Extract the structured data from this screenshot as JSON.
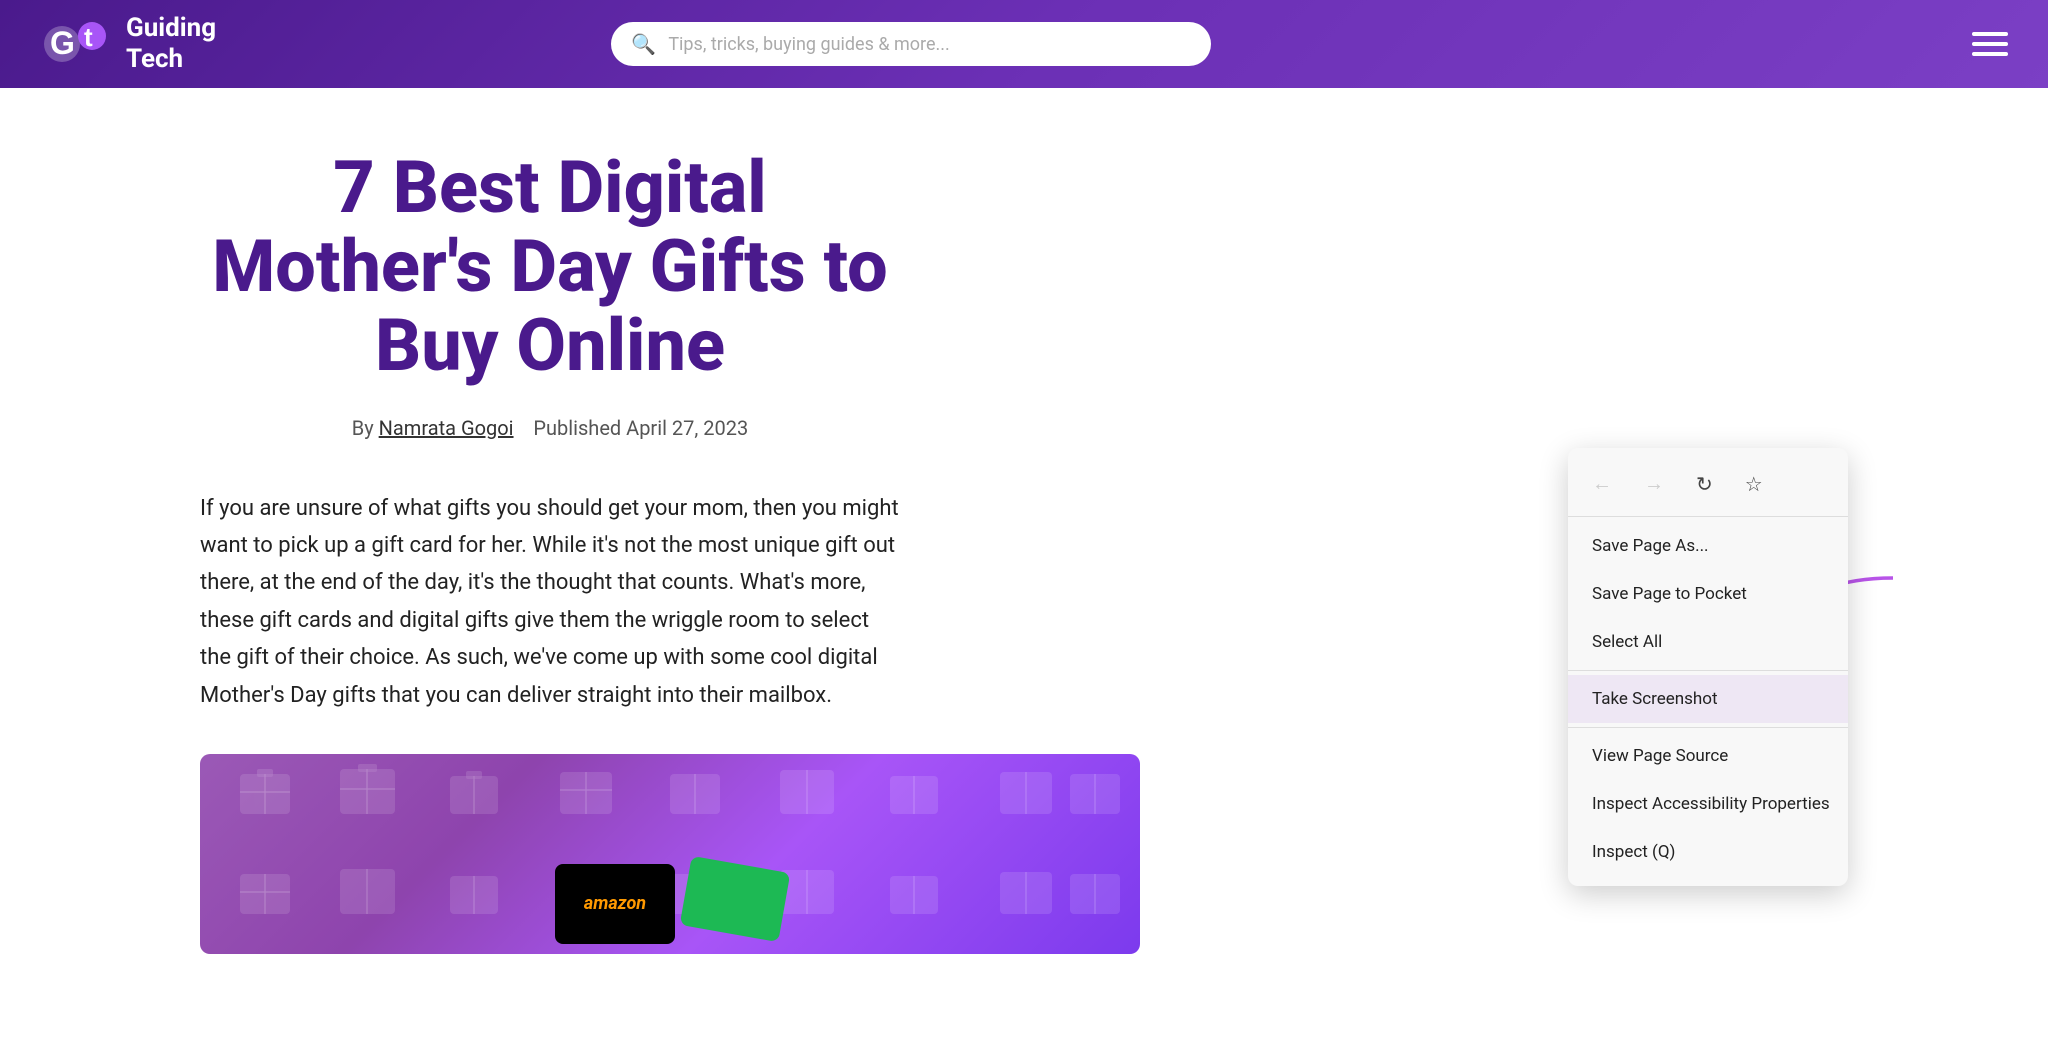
{
  "header": {
    "logo_text": "Guiding\nTech",
    "search_placeholder": "Tips, tricks, buying guides & more...",
    "hamburger_label": "Menu"
  },
  "article": {
    "title": "7 Best Digital Mother's Day Gifts to Buy Online",
    "meta_prefix": "By",
    "author": "Namrata Gogoi",
    "published": "Published April 27, 2023",
    "body": "If you are unsure of what gifts you should get your mom, then you might want to pick up a gift card for her. While it's not the most unique gift out there, at the end of the day, it's the thought that counts. What's more, these gift cards and digital gifts give them the wriggle room to select the gift of their choice. As such, we've come up with some cool digital Mother's Day gifts that you can deliver straight into their mailbox."
  },
  "context_menu": {
    "nav": {
      "back_label": "←",
      "forward_label": "→",
      "reload_label": "↻",
      "bookmark_label": "☆"
    },
    "items": [
      {
        "label": "Save Page As...",
        "divider_after": false
      },
      {
        "label": "Save Page to Pocket",
        "divider_after": false
      },
      {
        "label": "Select All",
        "divider_after": true
      },
      {
        "label": "Take Screenshot",
        "divider_after": true,
        "highlighted": true
      },
      {
        "label": "View Page Source",
        "divider_after": false
      },
      {
        "label": "Inspect Accessibility Properties",
        "divider_after": false
      },
      {
        "label": "Inspect (Q)",
        "divider_after": false
      }
    ]
  }
}
